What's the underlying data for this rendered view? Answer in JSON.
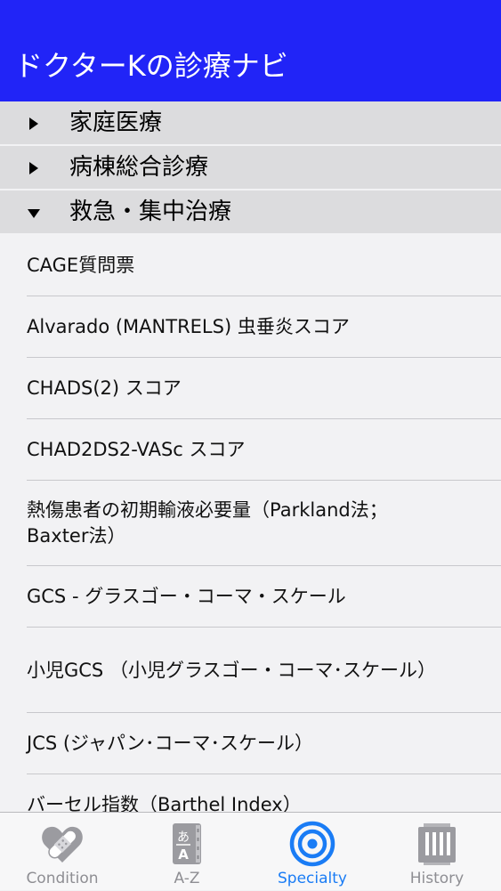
{
  "header": {
    "title": "ドクターKの診療ナビ",
    "background_color": "#2124f7"
  },
  "sections": [
    {
      "label": "家庭医療",
      "expanded": false,
      "icon": "triangle-right-icon"
    },
    {
      "label": "病棟総合診療",
      "expanded": false,
      "icon": "triangle-right-icon"
    },
    {
      "label": "救急・集中治療",
      "expanded": true,
      "icon": "triangle-down-icon"
    }
  ],
  "items": [
    "CAGE質問票",
    "Alvarado (MANTRELS) 虫垂炎スコア",
    "CHADS(2) スコア",
    "CHAD2DS2-VASc スコア",
    "熱傷患者の初期輸液必要量（Parkland法；Baxter法）",
    "GCS - グラスゴー・コーマ・スケール",
    "小児GCS （小児グラスゴー・コーマ･スケール）",
    "JCS (ジャパン･コーマ･スケール）",
    "バーセル指数（Barthel Index）"
  ],
  "tabs": [
    {
      "label": "Condition",
      "icon": "heart-bandage-icon",
      "active": false
    },
    {
      "label": "A-Z",
      "icon": "dictionary-book-icon",
      "active": false
    },
    {
      "label": "Specialty",
      "icon": "target-icon",
      "active": true
    },
    {
      "label": "History",
      "icon": "scroll-history-icon",
      "active": false
    }
  ],
  "colors": {
    "accent": "#1a7cf5",
    "inactive_tab": "#8e8e93",
    "section_bg": "#dcdcde"
  }
}
